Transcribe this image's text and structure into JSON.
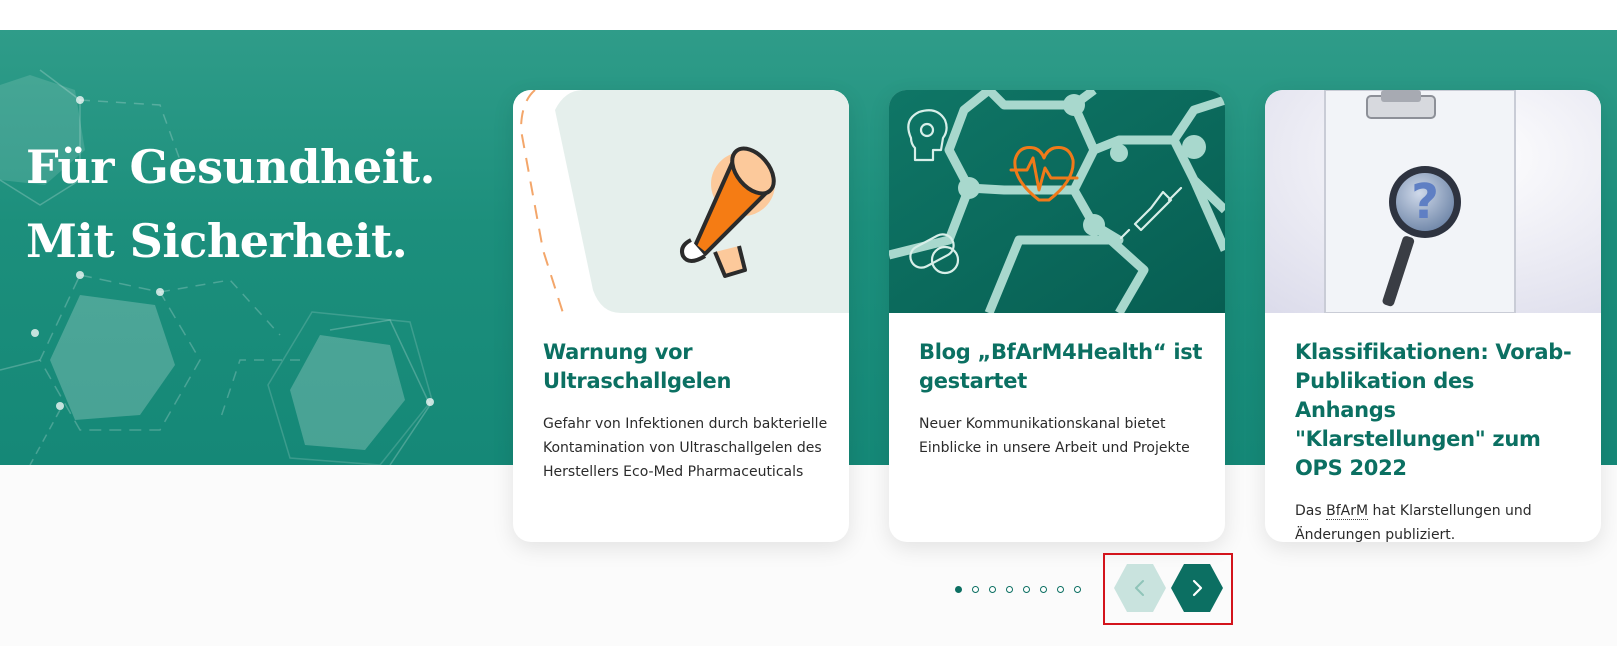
{
  "hero": {
    "title_line1": "Für Gesundheit.",
    "title_line2": "Mit Sicherheit."
  },
  "cards": [
    {
      "title": "Warnung vor Ultraschallgelen",
      "text": "Gefahr von Infektionen durch bakterielle Kontamination von Ultraschallgelen des Herstellers Eco-Med Pharmaceuticals",
      "icon": "megaphone-icon"
    },
    {
      "title": "Blog „BfArM4Health“ ist gestartet",
      "text": "Neuer Kommunikationskanal bietet Einblicke in unsere Arbeit und Projekte",
      "icon": "health-hexagon-network-icon"
    },
    {
      "title": "Klassifikationen: Vorab-Publikation des Anhangs \"Klarstellungen\" zum OPS 2022",
      "text_prefix": "Das ",
      "text_abbr": "BfArM",
      "text_suffix": " hat Klarstellungen und Änderungen publiziert.",
      "icon": "clipboard-magnifier-icon"
    }
  ],
  "carousel": {
    "slide_count": 8,
    "active_index": 0,
    "prev_icon": "chevron-left-icon",
    "next_icon": "chevron-right-icon",
    "prev_disabled": true
  },
  "colors": {
    "brand_green": "#0c6f62",
    "hero_bg": "#1c8f7c",
    "accent_orange": "#f07a1a",
    "highlight_red": "#d3141c"
  }
}
